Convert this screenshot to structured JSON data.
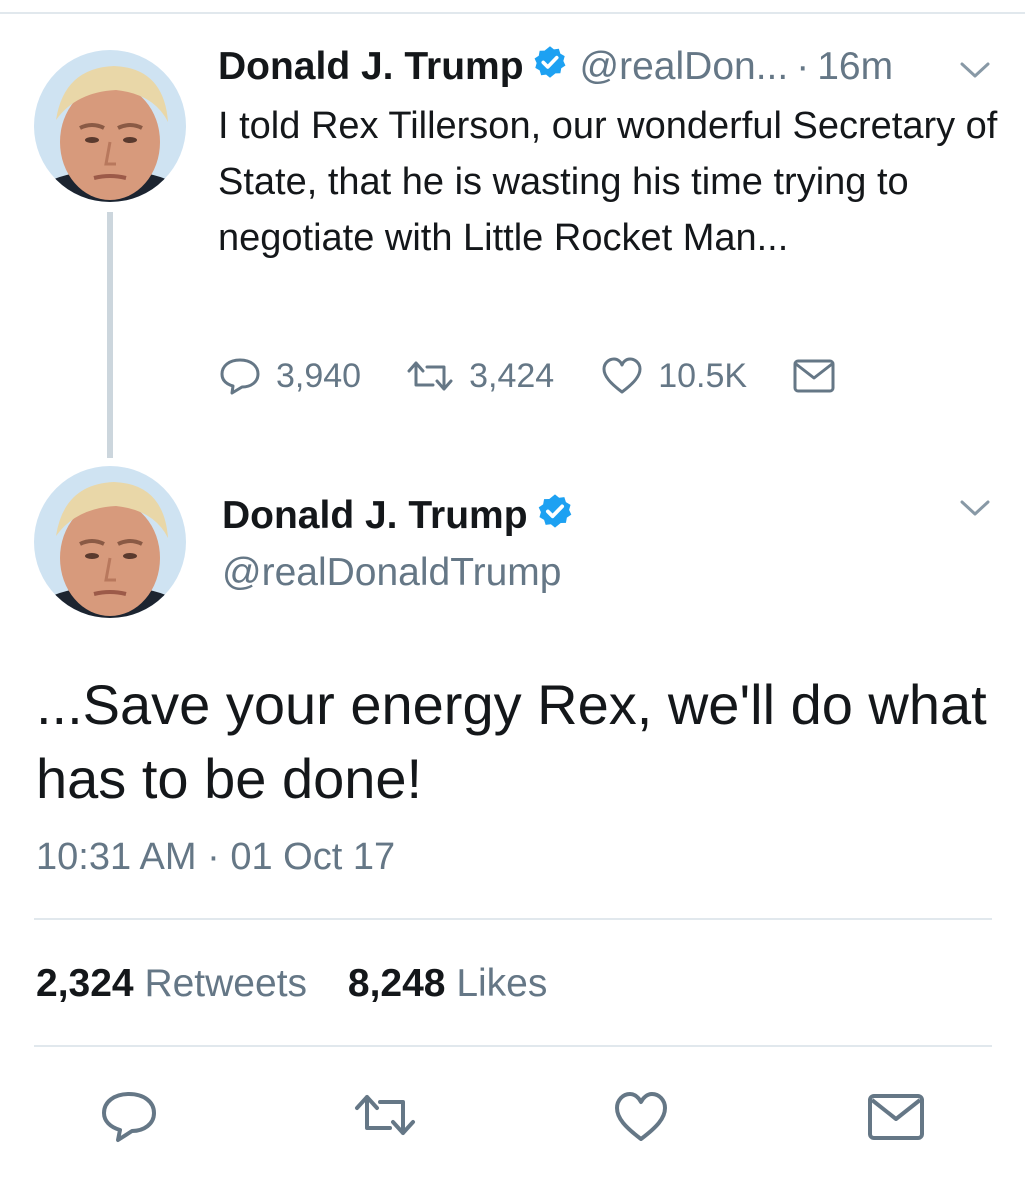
{
  "tweet1": {
    "name": "Donald J. Trump",
    "handle": "@realDon...",
    "separator": "·",
    "time": "16m",
    "text": "I told Rex Tillerson, our wonderful Secretary of State, that he is wasting his time trying to negotiate with Little Rocket Man...",
    "replies": "3,940",
    "retweets": "3,424",
    "likes": "10.5K"
  },
  "tweet2": {
    "name": "Donald J. Trump",
    "handle": "@realDonaldTrump",
    "text": "...Save your energy Rex, we'll do what has to be done!",
    "timestamp": "10:31 AM · 01 Oct 17",
    "retweet_count": "2,324",
    "retweet_label": "Retweets",
    "like_count": "8,248",
    "like_label": "Likes"
  },
  "icons": {
    "verified": "verified-badge-icon",
    "reply": "reply-icon",
    "retweet": "retweet-icon",
    "like": "heart-icon",
    "message": "envelope-icon",
    "menu": "chevron-down-icon"
  },
  "colors": {
    "text": "#14171a",
    "secondary": "#657786",
    "verified": "#1da1f2",
    "divider": "#e1e8ed",
    "thread": "#ccd6dd"
  }
}
